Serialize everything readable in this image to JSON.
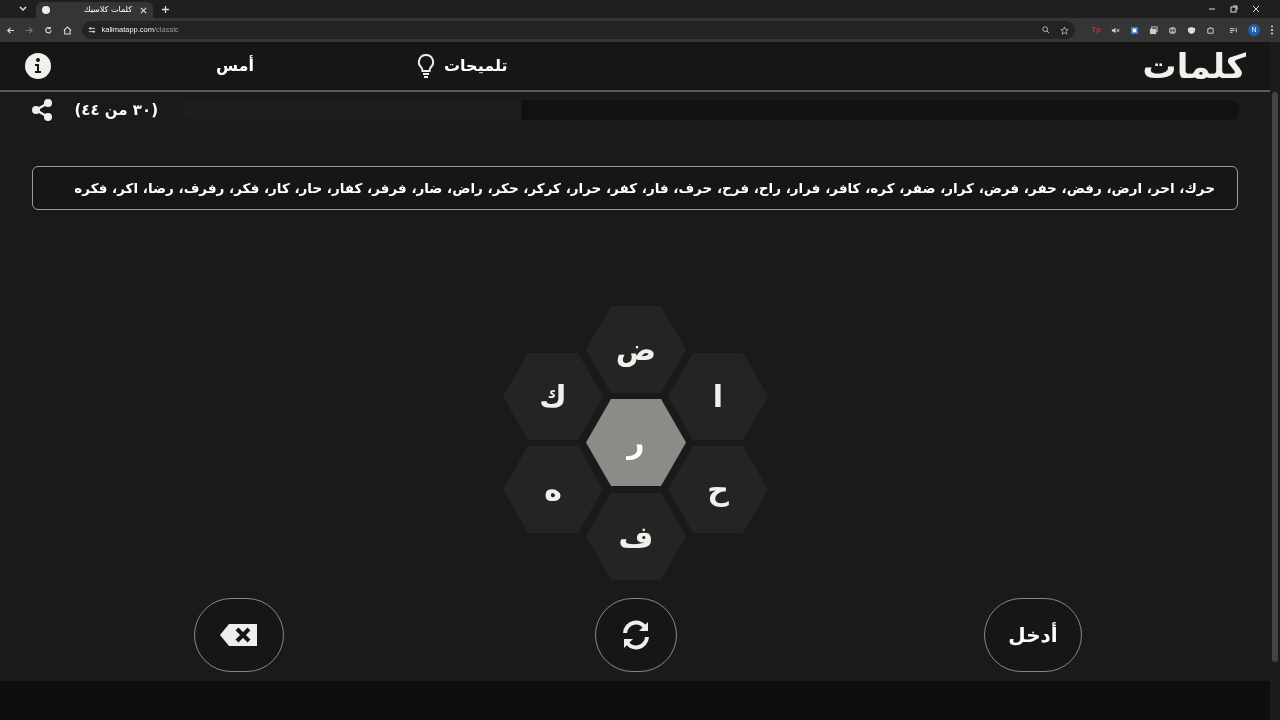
{
  "browser": {
    "tab_title": "كلمات كلاسيك",
    "url_domain": "kalimatapp.com",
    "url_path": "/classic",
    "extension_label": "Tp",
    "profile_initial": "N"
  },
  "header": {
    "logo": "كلمات",
    "hints": "تلميحات",
    "yesterday": "أمس"
  },
  "progress": {
    "count": "(٣٠ من ٤٤)",
    "level": 0.68
  },
  "found_words": "حرك، احر، ارض، رفض، حفر، فرض، كرار، ضفر، كره، كافر، فرار، راح، فرح، حرف، فار، كفر، حرار، كركر، حكر، راض، ضار، فرفر، كفار، حار، كار، فكر، رفرف، رضا، اكر، فكره",
  "letters": [
    {
      "letter": "ض",
      "kind": "top"
    },
    {
      "letter": "ك",
      "kind": "top_left"
    },
    {
      "letter": "ا",
      "kind": "top_right"
    },
    {
      "letter": "ر",
      "kind": "center"
    },
    {
      "letter": "ه",
      "kind": "bottom_left"
    },
    {
      "letter": "ح",
      "kind": "bottom_right"
    },
    {
      "letter": "ف",
      "kind": "bottom"
    }
  ],
  "enter_button": "أدخل"
}
